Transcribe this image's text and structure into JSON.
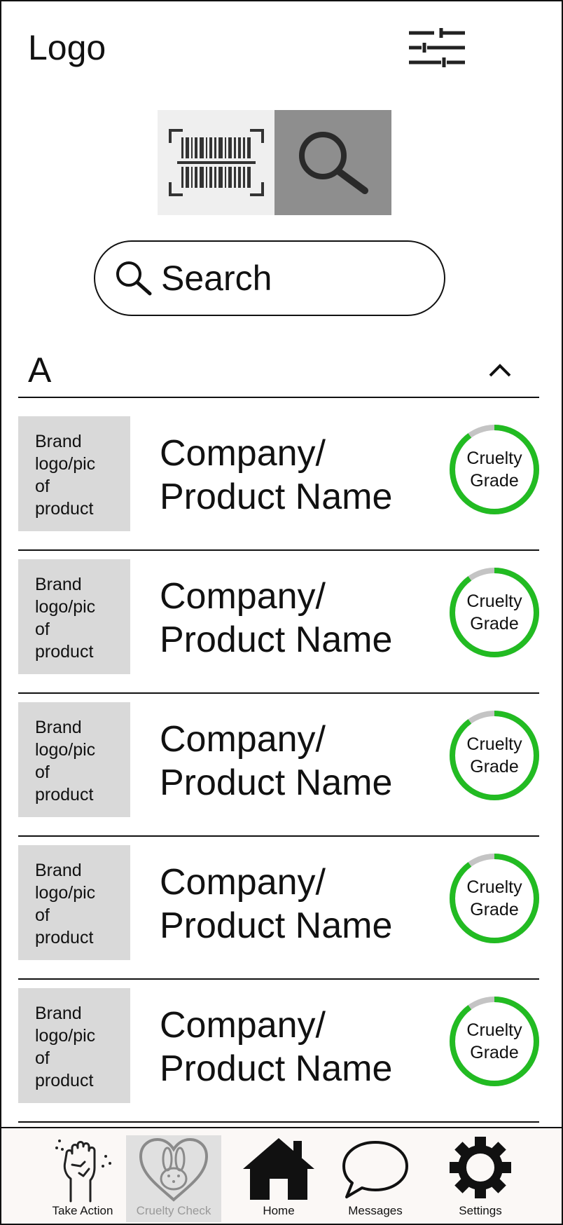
{
  "header": {
    "logo_text": "Logo",
    "filter_icon": "sliders-icon"
  },
  "mode_switch": {
    "options": [
      {
        "name": "barcode-scan",
        "icon": "barcode-icon",
        "selected": false
      },
      {
        "name": "search",
        "icon": "magnifier-icon",
        "selected": true
      }
    ]
  },
  "search": {
    "placeholder": "Search",
    "value": ""
  },
  "section": {
    "letter": "A",
    "expanded": true,
    "toggle_icon": "chevron-up-icon"
  },
  "products": [
    {
      "thumb_text": "Brand\nlogo/pic\nof\nproduct",
      "title": "Company/\nProduct Name",
      "grade_label": "Cruelty\nGrade",
      "grade_fraction": 0.9
    },
    {
      "thumb_text": "Brand\nlogo/pic\nof\nproduct",
      "title": "Company/\nProduct Name",
      "grade_label": "Cruelty\nGrade",
      "grade_fraction": 0.9
    },
    {
      "thumb_text": "Brand\nlogo/pic\nof\nproduct",
      "title": "Company/\nProduct Name",
      "grade_label": "Cruelty\nGrade",
      "grade_fraction": 0.9
    },
    {
      "thumb_text": "Brand\nlogo/pic\nof\nproduct",
      "title": "Company/\nProduct Name",
      "grade_label": "Cruelty\nGrade",
      "grade_fraction": 0.9
    },
    {
      "thumb_text": "Brand\nlogo/pic\nof\nproduct",
      "title": "Company/\nProduct Name",
      "grade_label": "Cruelty\nGrade",
      "grade_fraction": 0.9
    }
  ],
  "nav": {
    "items": [
      {
        "label": "Take Action",
        "icon": "raised-fist-icon",
        "active": false
      },
      {
        "label": "Cruelty Check",
        "icon": "bunny-heart-icon",
        "active": true
      },
      {
        "label": "Home",
        "icon": "home-icon",
        "active": false
      },
      {
        "label": "Messages",
        "icon": "chat-bubble-icon",
        "active": false
      },
      {
        "label": "Settings",
        "icon": "gear-icon",
        "active": false
      }
    ]
  },
  "colors": {
    "grade_ring": "#22bb22",
    "grade_track": "#c4c4c4",
    "thumb_bg": "#d9d9d9",
    "search_mode_bg": "#8e8e8e",
    "scan_mode_bg": "#efefef"
  }
}
